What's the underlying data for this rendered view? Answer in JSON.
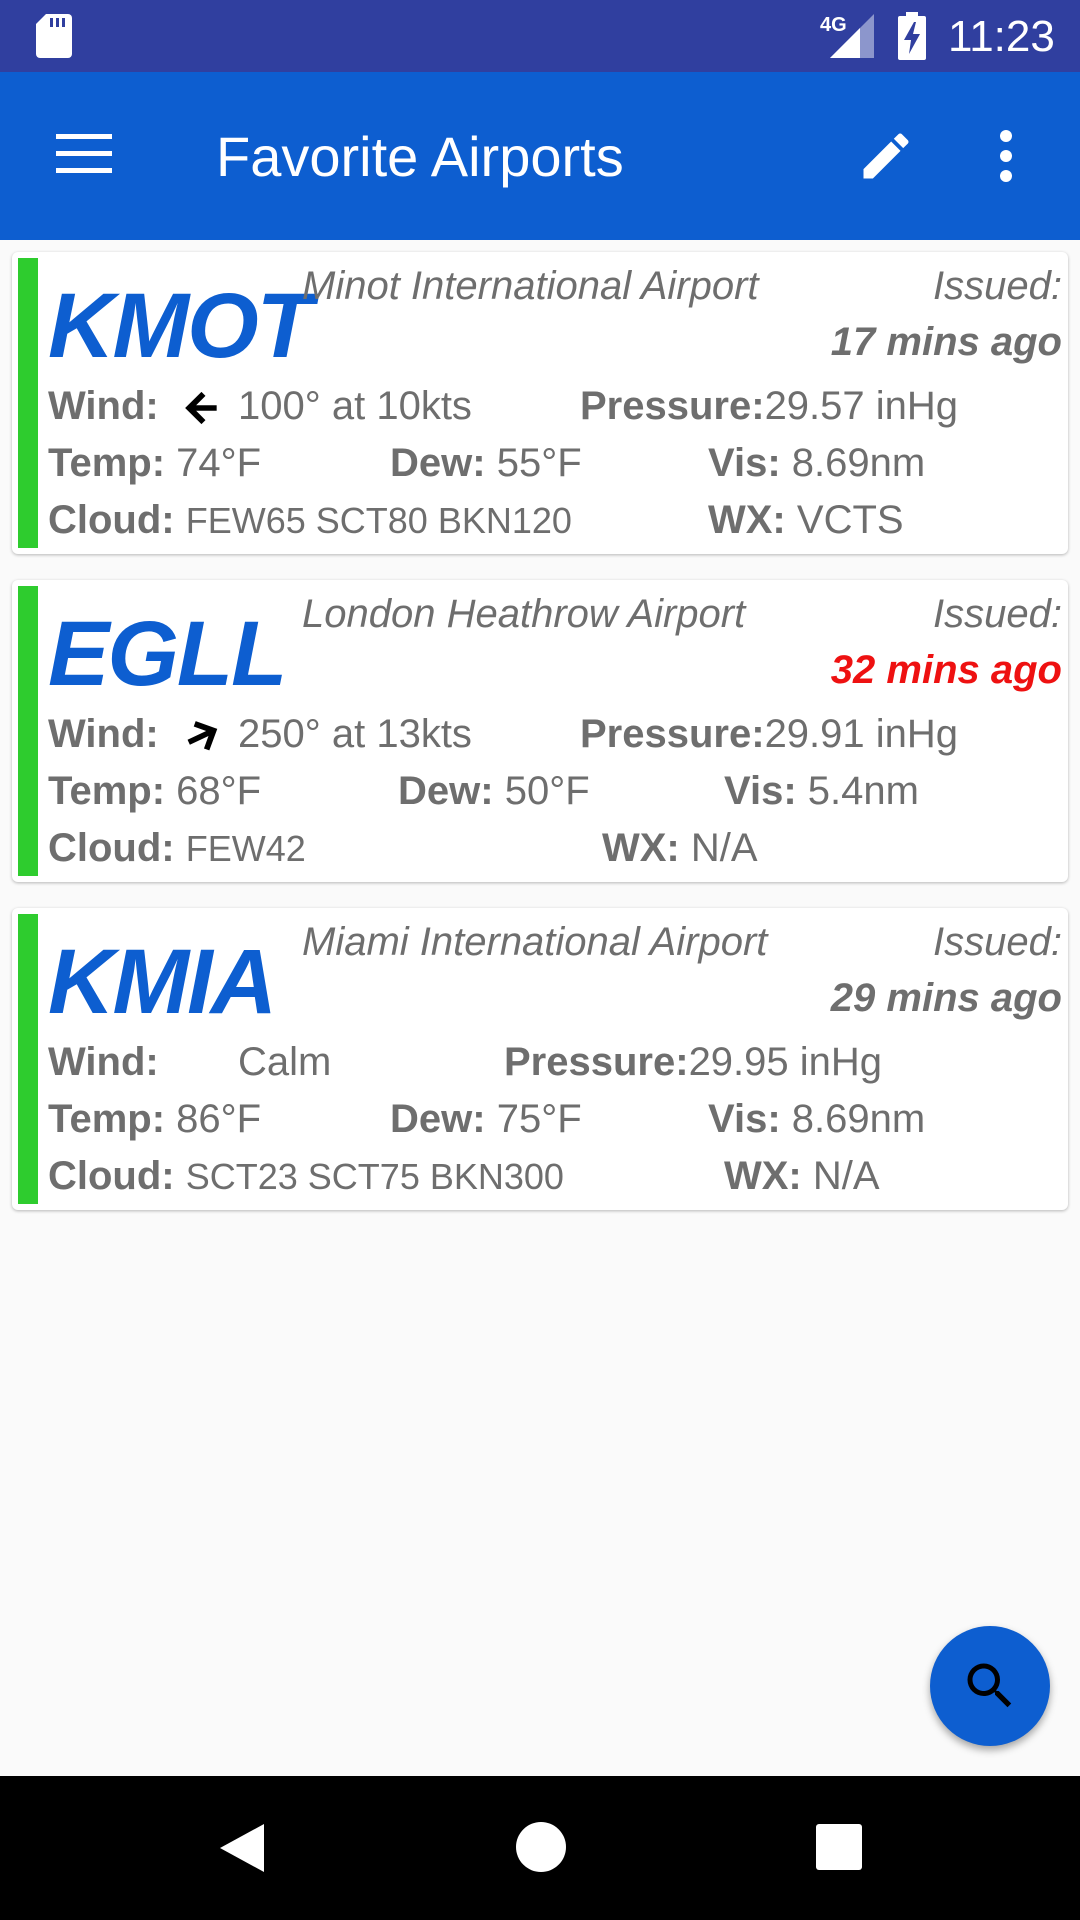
{
  "status_bar": {
    "network": "4G",
    "time": "11:23",
    "icons": [
      "sd-card-icon",
      "signal-icon",
      "battery-charging-icon"
    ]
  },
  "app_bar": {
    "title": "Favorite Airports",
    "icons": [
      "menu-icon",
      "edit-icon",
      "more-vert-icon"
    ],
    "color": "#0d5ed0"
  },
  "labels": {
    "issued": "Issued:",
    "wind": "Wind:",
    "pressure": "Pressure:",
    "temp": "Temp:",
    "dew": "Dew:",
    "vis": "Vis:",
    "cloud": "Cloud:",
    "wx": "WX:"
  },
  "airports": [
    {
      "icao": "KMOT",
      "name": "Minot International Airport",
      "issued": "17 mins ago",
      "issued_stale": false,
      "wind": "100° at 10kts",
      "wind_arrow": "arrow-left-icon",
      "pressure": "29.57 inHg",
      "temp": "74°F",
      "dew": "55°F",
      "vis": "8.69nm",
      "cloud": "FEW65 SCT80 BKN120",
      "wx": "VCTS",
      "flight_category_color": "#2ecc2e"
    },
    {
      "icao": "EGLL",
      "name": "London Heathrow Airport",
      "issued": "32 mins ago",
      "issued_stale": true,
      "wind": "250° at 13kts",
      "wind_arrow": "arrow-up-right-icon",
      "pressure": "29.91 inHg",
      "temp": "68°F",
      "dew": "50°F",
      "vis": "5.4nm",
      "cloud": "FEW42",
      "wx": "N/A",
      "flight_category_color": "#2ecc2e"
    },
    {
      "icao": "KMIA",
      "name": "Miami International Airport",
      "issued": "29 mins ago",
      "issued_stale": false,
      "wind": "Calm",
      "wind_arrow": "",
      "pressure": "29.95 inHg",
      "temp": "86°F",
      "dew": "75°F",
      "vis": "8.69nm",
      "cloud": "SCT23 SCT75 BKN300",
      "wx": "N/A",
      "flight_category_color": "#2ecc2e"
    }
  ],
  "fab": {
    "icon": "search-icon"
  },
  "nav_bar": {
    "icons": [
      "back-icon",
      "home-icon",
      "recents-icon"
    ]
  },
  "colors": {
    "stale": "#ee1111",
    "status_bar": "#303f9f"
  }
}
